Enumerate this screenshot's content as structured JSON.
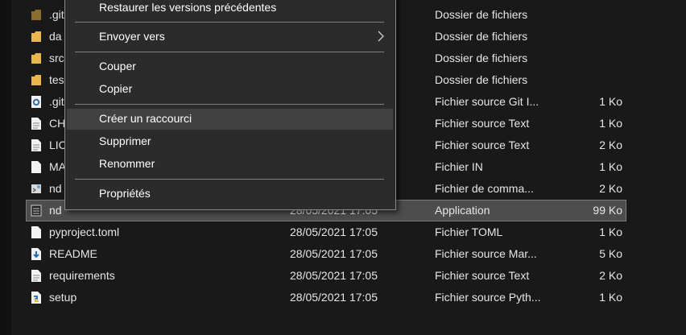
{
  "context_menu": {
    "items": [
      {
        "label": "Restaurer les versions précédentes"
      },
      {
        "label": "Envoyer vers",
        "submenu": true
      },
      {
        "label": "Couper"
      },
      {
        "label": "Copier"
      },
      {
        "label": "Créer un raccourci",
        "highlighted": true
      },
      {
        "label": "Supprimer"
      },
      {
        "label": "Renommer"
      },
      {
        "label": "Propriétés"
      }
    ]
  },
  "files": [
    {
      "name": ".gitignore_partial",
      "name_visible": ".git",
      "date": "",
      "type": "Dossier de fichiers",
      "size": "",
      "icon": "folder-icon"
    },
    {
      "name_visible": "da",
      "date": "",
      "type": "Dossier de fichiers",
      "size": "",
      "icon": "folder-icon"
    },
    {
      "name_visible": "src",
      "date": "",
      "type": "Dossier de fichiers",
      "size": "",
      "icon": "folder-icon"
    },
    {
      "name_visible": "tes",
      "date": "",
      "type": "Dossier de fichiers",
      "size": "",
      "icon": "folder-icon"
    },
    {
      "name_visible": ".git",
      "date": "",
      "type": "Fichier source Git I...",
      "size": "1 Ko",
      "icon": "git-config-icon"
    },
    {
      "name_visible": "CH",
      "date": "",
      "type": "Fichier source Text",
      "size": "1 Ko",
      "icon": "text-file-icon"
    },
    {
      "name_visible": "LIC",
      "date": "",
      "type": "Fichier source Text",
      "size": "2 Ko",
      "icon": "text-file-icon"
    },
    {
      "name_visible": "MA",
      "date": "",
      "type": "Fichier IN",
      "size": "1 Ko",
      "icon": "file-icon"
    },
    {
      "name_visible": "nd",
      "date": "",
      "type": "Fichier de comma...",
      "size": "2 Ko",
      "icon": "batch-file-icon"
    },
    {
      "name_visible": "nd",
      "date": "28/05/2021 17:05",
      "type": "Application",
      "size": "99 Ko",
      "icon": "application-icon",
      "selected": true
    },
    {
      "name_visible": "pyproject.toml",
      "date": "28/05/2021 17:05",
      "type": "Fichier TOML",
      "size": "1 Ko",
      "icon": "file-icon"
    },
    {
      "name_visible": "README",
      "date": "28/05/2021 17:05",
      "type": "Fichier source Mar...",
      "size": "5 Ko",
      "icon": "markdown-file-icon"
    },
    {
      "name_visible": "requirements",
      "date": "28/05/2021 17:05",
      "type": "Fichier source Text",
      "size": "2 Ko",
      "icon": "text-file-icon"
    },
    {
      "name_visible": "setup",
      "date": "28/05/2021 17:05",
      "type": "Fichier source Pyth...",
      "size": "1 Ko",
      "icon": "python-file-icon"
    }
  ],
  "colors": {
    "background": "#191919",
    "menu_background": "#2b2b2b",
    "menu_highlight": "#414141",
    "selection": "#4d4d4d",
    "folder": "#e8b84a"
  }
}
